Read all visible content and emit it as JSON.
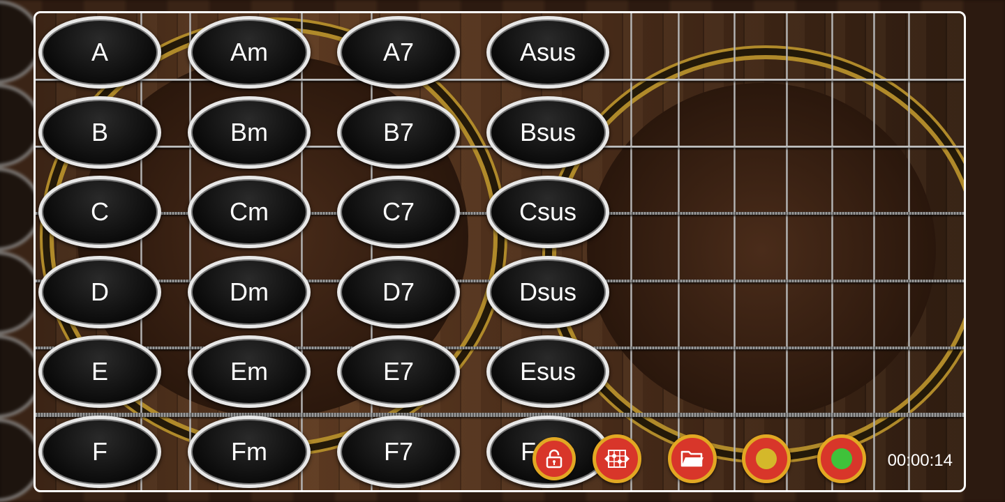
{
  "chords": [
    [
      "A",
      "Am",
      "A7",
      "Asus"
    ],
    [
      "B",
      "Bm",
      "B7",
      "Bsus"
    ],
    [
      "C",
      "Cm",
      "C7",
      "Csus"
    ],
    [
      "D",
      "Dm",
      "D7",
      "Dsus"
    ],
    [
      "E",
      "Em",
      "E7",
      "Esus"
    ],
    [
      "F",
      "Fm",
      "F7",
      "Fsus"
    ]
  ],
  "toolbar": {
    "buttons": [
      {
        "name": "lock-button",
        "icon": "lock-icon"
      },
      {
        "name": "chord-editor-button",
        "icon": "chord-diagram-icon"
      },
      {
        "name": "open-folder-button",
        "icon": "folder-icon"
      },
      {
        "name": "record-button",
        "icon": "yellow-dot-icon",
        "dot_color": "#d4b82a"
      },
      {
        "name": "play-button",
        "icon": "green-dot-icon",
        "dot_color": "#3fc23a"
      }
    ],
    "timer": "00:00:14"
  },
  "colors": {
    "button_fill": "#d8362a",
    "button_ring": "#e2a823",
    "chord_border": "#e8e8e8",
    "frame_border": "#ffffff"
  }
}
